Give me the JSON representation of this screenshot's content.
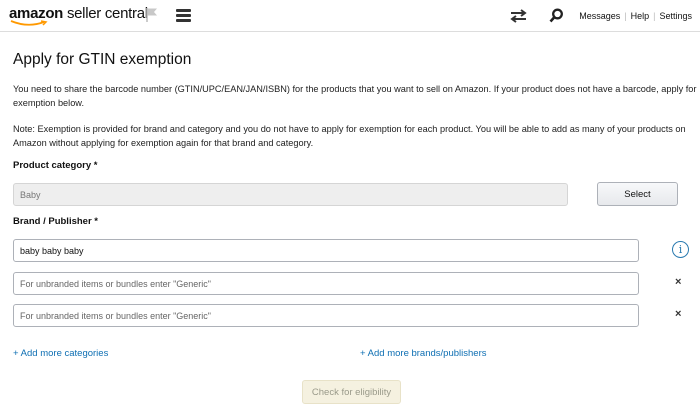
{
  "header": {
    "logo_brand": "amazon",
    "logo_suffix": "seller central",
    "links": [
      "Messages",
      "Help",
      "Settings"
    ]
  },
  "page": {
    "title": "Apply for GTIN exemption",
    "intro": "You need to share the barcode number (GTIN/UPC/EAN/JAN/ISBN) for the products that you want to sell on Amazon. If your product does not have a barcode, apply for exemption below.",
    "note": "Note: Exemption is provided for brand and category and you do not have to apply for exemption for each product. You will be able to add as many of your products on Amazon without applying for exemption again for that brand and category."
  },
  "form": {
    "category_label": "Product category *",
    "category_value": "Baby",
    "select_label": "Select",
    "brand_label": "Brand / Publisher *",
    "brands": [
      {
        "value": "baby baby baby",
        "placeholder": "For unbranded items or bundles enter \"Generic\""
      },
      {
        "value": "",
        "placeholder": "For unbranded items or bundles enter \"Generic\""
      },
      {
        "value": "",
        "placeholder": "For unbranded items or bundles enter \"Generic\""
      }
    ],
    "remove_symbol": "×",
    "info_symbol": "i",
    "add_categories": "+ Add more categories",
    "add_brands": "+ Add more brands/publishers",
    "check_button": "Check for eligibility"
  },
  "icons": {
    "flag": "flag-icon",
    "menu": "hamburger-menu-icon",
    "swap": "swap-arrows-icon",
    "search": "search-icon",
    "info": "info-icon",
    "remove": "close-icon"
  },
  "colors": {
    "link": "#0e6fb3",
    "info": "#2a7ab0",
    "logo_smile": "#f90"
  }
}
